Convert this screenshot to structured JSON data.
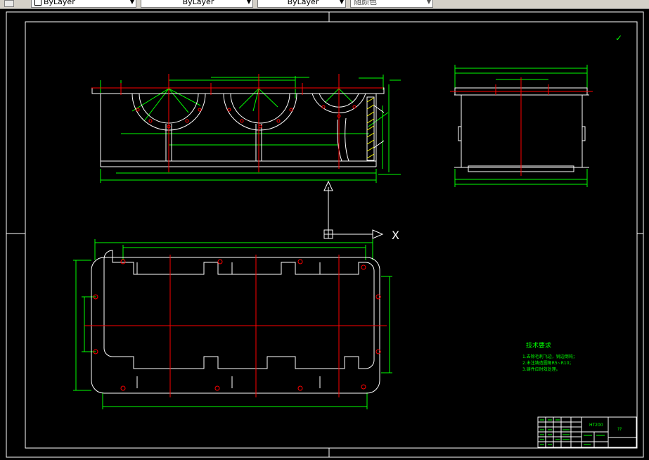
{
  "toolbar": {
    "linetype": "ByLayer",
    "lineweight": "ByLayer",
    "plotstyle": "ByLayer",
    "color_control": "随颜色"
  },
  "drawing": {
    "checkmark": "✓",
    "tech_title": "技术要求",
    "tech_notes": [
      "1.去除毛刺飞边，锐边倒钝；",
      "2.未注铸造圆角R5~R10；",
      "3.铸件应时效处理。"
    ],
    "ucs_x_label": "X",
    "titleblock": {
      "name": "HT200",
      "right": "??"
    },
    "colors": {
      "background": "#000000",
      "outline": "#ffffff",
      "dimension": "#00ff00",
      "centerline": "#ff0000",
      "hatch": "#ffff00"
    }
  }
}
